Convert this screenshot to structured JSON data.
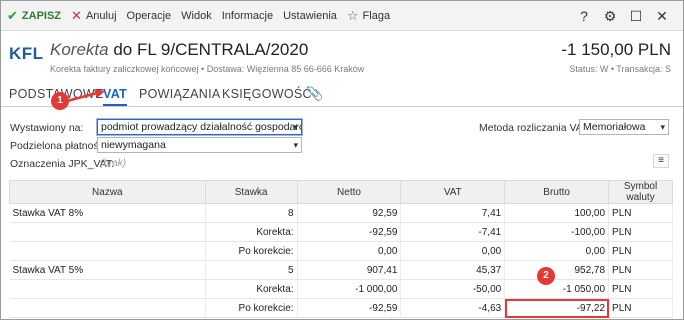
{
  "toolbar": {
    "save": "ZAPISZ",
    "cancel": "Anuluj",
    "operations": "Operacje",
    "view": "Widok",
    "info": "Informacje",
    "settings": "Ustawienia",
    "flag": "Flaga",
    "icons": {
      "help": "?",
      "gear": "⚙",
      "maximize": "☐",
      "close": "✕"
    }
  },
  "header": {
    "logo": "KFL",
    "doc_kind": "Korekta",
    "doc_number": "do FL 9/CENTRALA/2020",
    "subtitle": "Korekta faktury zaliczkowej końcowej  •  Dostawa: Więzienna  85  66-666 Kraków",
    "amount": "-1 150,00 PLN",
    "status": "Status: W  •  Transakcja: S"
  },
  "tabs": [
    {
      "label": "PODSTAWOWE"
    },
    {
      "label": "VAT"
    },
    {
      "label": "POWIĄZANIA"
    },
    {
      "label": "KSIĘGOWOŚĆ"
    }
  ],
  "form": {
    "issued_by_label": "Wystawiony na:",
    "issued_by_value": "podmiot prowadzący działalność gospodarczą",
    "split_payment_label": "Podzielona płatność:",
    "split_payment_value": "niewymagana",
    "jpk_label": "Oznaczenia JPK_VAT:",
    "jpk_value": "(brak)",
    "vat_method_label": "Metoda rozliczania VAT:",
    "vat_method_value": "Memoriałowa"
  },
  "markers": {
    "m1": "1",
    "m2": "2"
  },
  "table": {
    "headers": [
      "Nazwa",
      "Stawka",
      "Netto",
      "VAT",
      "Brutto",
      "Symbol waluty"
    ],
    "rows": [
      [
        "Stawka VAT 8%",
        "8",
        "92,59",
        "7,41",
        "100,00",
        "PLN"
      ],
      [
        "",
        "Korekta:",
        "-92,59",
        "-7,41",
        "-100,00",
        "PLN"
      ],
      [
        "",
        "Po korekcie:",
        "0,00",
        "0,00",
        "0,00",
        "PLN"
      ],
      [
        "Stawka VAT 5%",
        "5",
        "907,41",
        "45,37",
        "952,78",
        "PLN"
      ],
      [
        "",
        "Korekta:",
        "-1 000,00",
        "-50,00",
        "-1 050,00",
        "PLN"
      ],
      [
        "",
        "Po korekcie:",
        "-92,59",
        "-4,63",
        "-97,22",
        "PLN"
      ]
    ]
  }
}
